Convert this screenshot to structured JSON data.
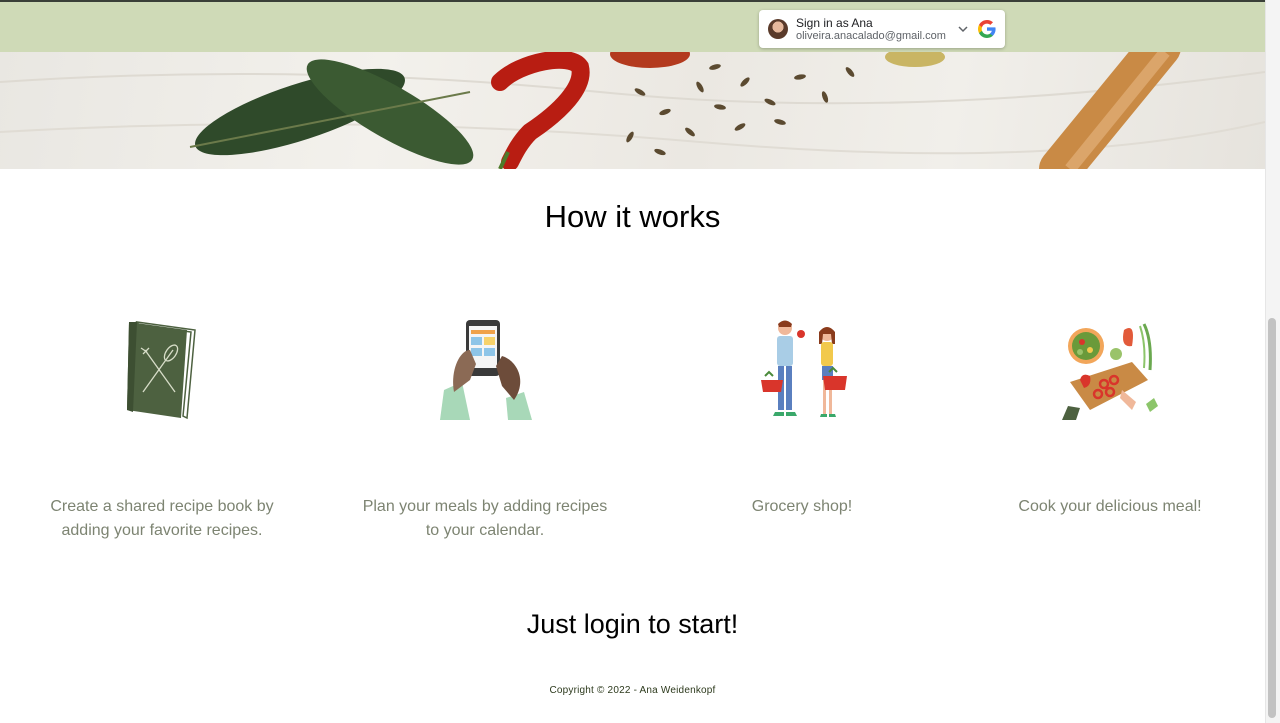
{
  "signin": {
    "title": "Sign in as Ana",
    "email": "oliveira.anacalado@gmail.com"
  },
  "how_it_works": {
    "title": "How it works",
    "steps": [
      {
        "caption_line1": "Create a shared recipe book by",
        "caption_line2": "adding your favorite recipes.",
        "icon": "recipe-book-icon"
      },
      {
        "caption_line1": "Plan your meals by adding recipes",
        "caption_line2": "to your calendar.",
        "icon": "phone-calendar-icon"
      },
      {
        "caption_line1": "Grocery shop!",
        "caption_line2": "",
        "icon": "grocery-shoppers-icon"
      },
      {
        "caption_line1": "Cook your delicious meal!",
        "caption_line2": "",
        "icon": "cooking-board-icon"
      }
    ]
  },
  "cta": {
    "text": "Just login to start!"
  },
  "footer": {
    "copyright": "Copyright © 2022 - Ana Weidenkopf"
  },
  "colors": {
    "header": "#cfdab7",
    "caption": "#7d8472",
    "footer": "#2d3a1d",
    "book": "#4d6140"
  }
}
